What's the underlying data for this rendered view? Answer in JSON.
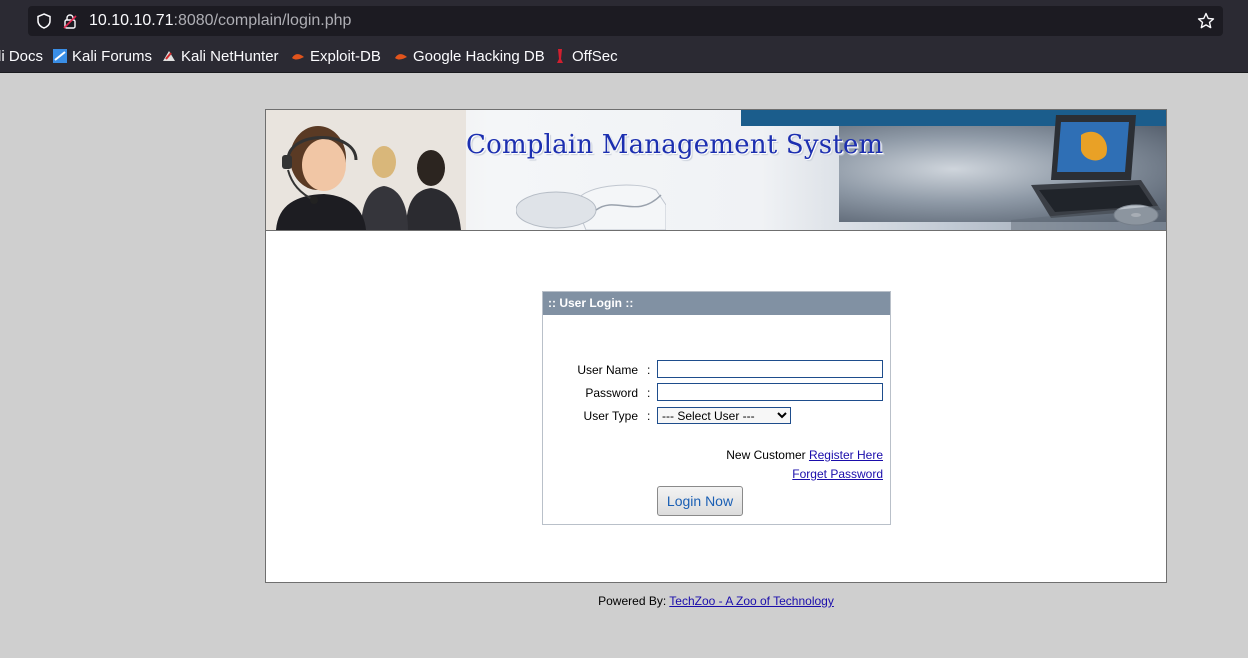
{
  "browser": {
    "url_host": "10.10.10.71",
    "url_rest": ":8080/complain/login.php",
    "bookmarks": [
      {
        "label": "li Docs",
        "icon": "kali-docs-icon"
      },
      {
        "label": "Kali Forums",
        "icon": "kali-forums-icon"
      },
      {
        "label": "Kali NetHunter",
        "icon": "kali-nethunter-icon"
      },
      {
        "label": "Exploit-DB",
        "icon": "exploit-db-icon"
      },
      {
        "label": "Google Hacking DB",
        "icon": "ghdb-icon"
      },
      {
        "label": "OffSec",
        "icon": "offsec-icon"
      }
    ]
  },
  "banner": {
    "title": "Complain Management System"
  },
  "login": {
    "header": ":: User Login ::",
    "username_label": "User Name",
    "password_label": "Password",
    "usertype_label": "User Type",
    "colon": ":",
    "username_value": "",
    "password_value": "",
    "usertype_selected": "--- Select User ---",
    "new_customer_text": "New Customer",
    "register_link": "Register Here",
    "forget_link": "Forget Password",
    "submit_label": "Login Now"
  },
  "footer": {
    "prefix": "Powered By:",
    "link": "TechZoo - A Zoo of Technology"
  },
  "colors": {
    "header_bar": "#8191a3",
    "title": "#1c2fb0",
    "link": "#1a0dab"
  }
}
